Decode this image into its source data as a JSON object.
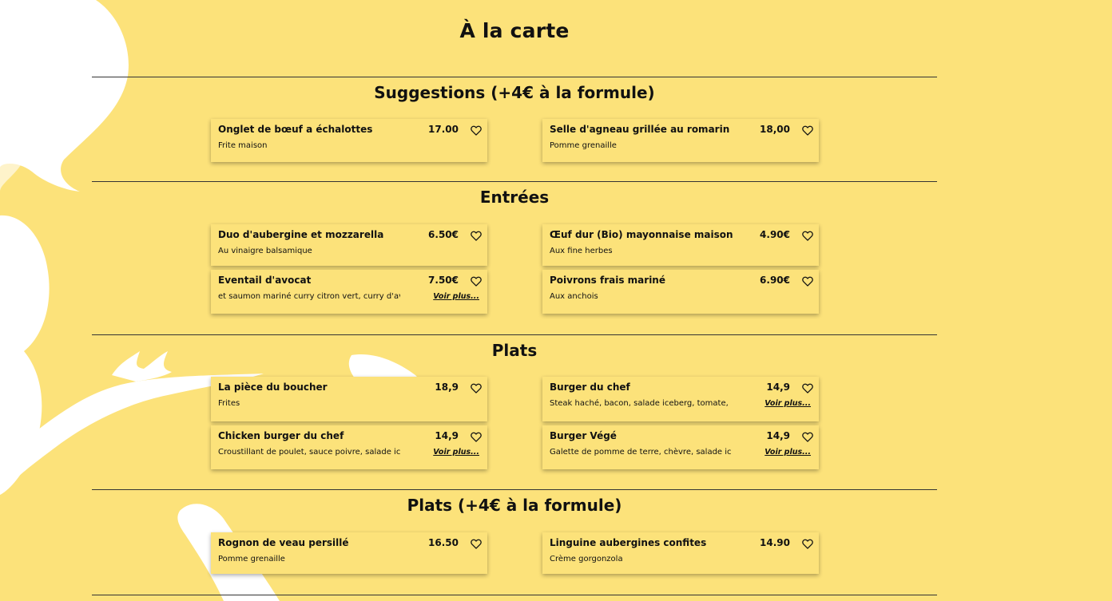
{
  "page": {
    "title": "À la carte"
  },
  "sections": [
    {
      "title": "Suggestions (+4€ à la formule)",
      "items": [
        {
          "name": "Onglet de bœuf a échalottes",
          "price": "17.00",
          "desc": "Frite maison"
        },
        {
          "name": "Selle d'agneau grillée au romarin",
          "price": "18,00",
          "desc": "Pomme grenaille"
        }
      ]
    },
    {
      "title": "Entrées",
      "items": [
        {
          "name": "Duo d'aubergine et mozzarella",
          "price": "6.50€",
          "desc": "Au vinaigre balsamique"
        },
        {
          "name": "Œuf dur (Bio) mayonnaise maison",
          "price": "4.90€",
          "desc": "Aux fine herbes"
        },
        {
          "name": "Eventail d'avocat",
          "price": "7.50€",
          "desc": "et saumon mariné curry citron vert, curry d'av...",
          "more": "Voir plus..."
        },
        {
          "name": "Poivrons frais mariné",
          "price": "6.90€",
          "desc": "Aux anchois"
        }
      ]
    },
    {
      "title": "Plats",
      "items": [
        {
          "name": "La pièce du boucher",
          "price": "18,9",
          "desc": "Frites"
        },
        {
          "name": "Burger du chef",
          "price": "14,9",
          "desc": "Steak haché, bacon, salade iceberg, tomate, ...",
          "more": "Voir plus..."
        },
        {
          "name": "Chicken burger du chef",
          "price": "14,9",
          "desc": "Croustillant de poulet, sauce poivre, salade ic...",
          "more": "Voir plus..."
        },
        {
          "name": "Burger Végé",
          "price": "14,9",
          "desc": "Galette de pomme de terre, chèvre, salade ic...",
          "more": "Voir plus..."
        }
      ]
    },
    {
      "title": "Plats (+4€ à la formule)",
      "items": [
        {
          "name": "Rognon de veau persillé",
          "price": "16.50",
          "desc": "Pomme grenaille"
        },
        {
          "name": "Linguine aubergines confites",
          "price": "14.90",
          "desc": "Crème gorgonzola"
        }
      ]
    }
  ],
  "icons": {
    "favorite": "heart-outline-icon"
  },
  "colors": {
    "background": "#fce27a",
    "decoration": "#ffffff",
    "text": "#111111"
  }
}
